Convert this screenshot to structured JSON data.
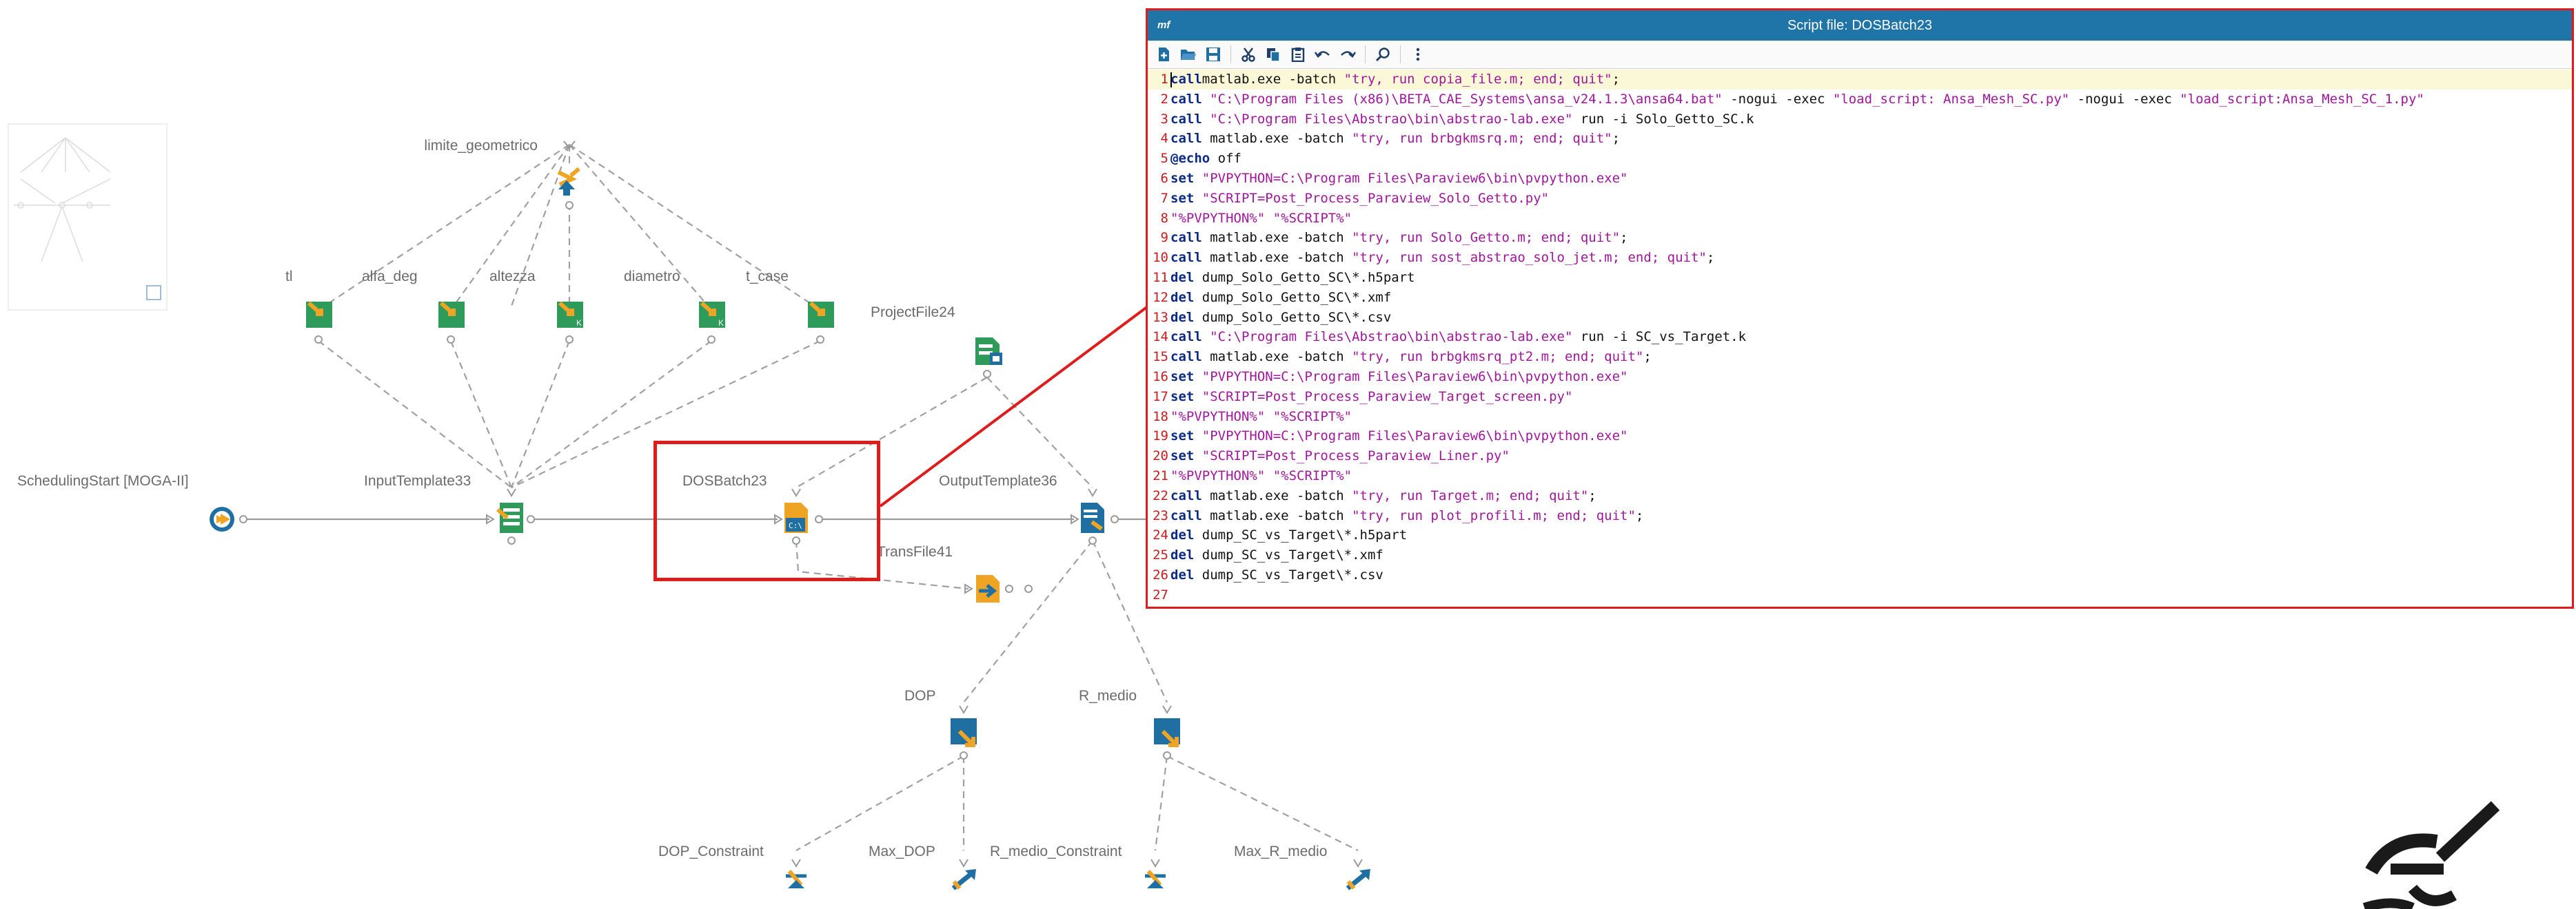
{
  "workflow": {
    "nodes": [
      {
        "id": "limite_geometrico",
        "label": "limite_geometrico",
        "icon": "transfer-function-icon"
      },
      {
        "id": "tl",
        "label": "tl",
        "icon": "input-variable-icon"
      },
      {
        "id": "alfa_deg",
        "label": "alfa_deg",
        "icon": "input-variable-icon"
      },
      {
        "id": "altezza",
        "label": "altezza",
        "icon": "input-variable-k-icon"
      },
      {
        "id": "diametro",
        "label": "diametro",
        "icon": "input-variable-k-icon"
      },
      {
        "id": "t_case",
        "label": "t_case",
        "icon": "input-variable-icon"
      },
      {
        "id": "ProjectFile24",
        "label": "ProjectFile24",
        "icon": "project-file-icon"
      },
      {
        "id": "SchedulingStart",
        "label": "SchedulingStart [MOGA-II]",
        "icon": "scheduler-start-icon"
      },
      {
        "id": "InputTemplate33",
        "label": "InputTemplate33",
        "icon": "input-template-icon"
      },
      {
        "id": "DOSBatch23",
        "label": "DOSBatch23",
        "icon": "dos-batch-icon"
      },
      {
        "id": "OutputTemplate36",
        "label": "OutputTemplate36",
        "icon": "output-template-icon"
      },
      {
        "id": "TransFile41",
        "label": "TransFile41",
        "icon": "transfer-file-icon"
      },
      {
        "id": "DOP",
        "label": "DOP",
        "icon": "output-variable-icon"
      },
      {
        "id": "R_medio",
        "label": "R_medio",
        "icon": "output-variable-icon"
      },
      {
        "id": "DOP_Constraint",
        "label": "DOP_Constraint",
        "icon": "constraint-icon"
      },
      {
        "id": "Max_DOP",
        "label": "Max_DOP",
        "icon": "objective-max-icon"
      },
      {
        "id": "R_medio_Constraint",
        "label": "R_medio_Constraint",
        "icon": "constraint-icon"
      },
      {
        "id": "Max_R_medio",
        "label": "Max_R_medio",
        "icon": "objective-max-icon"
      }
    ]
  },
  "script_window": {
    "title": "Script file: DOSBatch23",
    "logo": "mf",
    "toolbar": [
      "new-file-icon",
      "open-folder-icon",
      "save-icon",
      "cut-icon",
      "copy-icon",
      "paste-icon",
      "undo-icon",
      "redo-icon",
      "search-icon",
      "more-icon"
    ],
    "lines": [
      {
        "n": "1",
        "t": [
          [
            "kw",
            "call"
          ],
          [
            "",
            "matlab.exe -batch "
          ],
          [
            "str",
            "\"try, run copia_file.m; end; quit\""
          ],
          [
            "",
            ";"
          ]
        ]
      },
      {
        "n": "2",
        "t": [
          [
            "kw",
            "call"
          ],
          [
            "str",
            " \"C:\\Program Files (x86)\\BETA_CAE_Systems\\ansa_v24.1.3\\ansa64.bat\""
          ],
          [
            "",
            " -nogui -exec "
          ],
          [
            "str",
            "\"load_script: Ansa_Mesh_SC.py\""
          ],
          [
            "",
            " -nogui -exec "
          ],
          [
            "str",
            "\"load_script:Ansa_Mesh_SC_1.py\""
          ]
        ]
      },
      {
        "n": "3",
        "t": [
          [
            "kw",
            "call"
          ],
          [
            "str",
            " \"C:\\Program Files\\Abstrao\\bin\\abstrao-lab.exe\""
          ],
          [
            "",
            " run -i Solo_Getto_SC.k"
          ]
        ]
      },
      {
        "n": "4",
        "t": [
          [
            "kw",
            "call"
          ],
          [
            "",
            " matlab.exe -batch "
          ],
          [
            "str",
            "\"try, run brbgkmsrq.m; end; quit\""
          ],
          [
            "",
            ";"
          ]
        ]
      },
      {
        "n": "5",
        "t": [
          [
            "kw",
            "@echo"
          ],
          [
            "",
            " off"
          ]
        ]
      },
      {
        "n": "6",
        "t": [
          [
            "kw",
            "set"
          ],
          [
            "str",
            " \"PVPYTHON=C:\\Program Files\\Paraview6\\bin\\pvpython.exe\""
          ]
        ]
      },
      {
        "n": "7",
        "t": [
          [
            "kw",
            "set"
          ],
          [
            "str",
            " \"SCRIPT=Post_Process_Paraview_Solo_Getto.py\""
          ]
        ]
      },
      {
        "n": "8",
        "t": [
          [
            "str",
            "\"%PVPYTHON%\" \"%SCRIPT%\""
          ]
        ]
      },
      {
        "n": "9",
        "t": [
          [
            "kw",
            "call"
          ],
          [
            "",
            " matlab.exe -batch "
          ],
          [
            "str",
            "\"try, run Solo_Getto.m; end; quit\""
          ],
          [
            "",
            ";"
          ]
        ]
      },
      {
        "n": "10",
        "t": [
          [
            "kw",
            "call"
          ],
          [
            "",
            " matlab.exe -batch "
          ],
          [
            "str",
            "\"try, run sost_abstrao_solo_jet.m; end; quit\""
          ],
          [
            "",
            ";"
          ]
        ]
      },
      {
        "n": "11",
        "t": [
          [
            "kw",
            "del"
          ],
          [
            "",
            " dump_Solo_Getto_SC\\*.h5part"
          ]
        ]
      },
      {
        "n": "12",
        "t": [
          [
            "kw",
            "del"
          ],
          [
            "",
            " dump_Solo_Getto_SC\\*.xmf"
          ]
        ]
      },
      {
        "n": "13",
        "t": [
          [
            "kw",
            "del"
          ],
          [
            "",
            " dump_Solo_Getto_SC\\*.csv"
          ]
        ]
      },
      {
        "n": "14",
        "t": [
          [
            "kw",
            "call"
          ],
          [
            "str",
            " \"C:\\Program Files\\Abstrao\\bin\\abstrao-lab.exe\""
          ],
          [
            "",
            " run -i SC_vs_Target.k"
          ]
        ]
      },
      {
        "n": "15",
        "t": [
          [
            "kw",
            "call"
          ],
          [
            "",
            " matlab.exe -batch "
          ],
          [
            "str",
            "\"try, run brbgkmsrq_pt2.m; end; quit\""
          ],
          [
            "",
            ";"
          ]
        ]
      },
      {
        "n": "16",
        "t": [
          [
            "kw",
            "set"
          ],
          [
            "str",
            " \"PVPYTHON=C:\\Program Files\\Paraview6\\bin\\pvpython.exe\""
          ]
        ]
      },
      {
        "n": "17",
        "t": [
          [
            "kw",
            "set"
          ],
          [
            "str",
            " \"SCRIPT=Post_Process_Paraview_Target_screen.py\""
          ]
        ]
      },
      {
        "n": "18",
        "t": [
          [
            "str",
            "\"%PVPYTHON%\" \"%SCRIPT%\""
          ]
        ]
      },
      {
        "n": "19",
        "t": [
          [
            "kw",
            "set"
          ],
          [
            "str",
            " \"PVPYTHON=C:\\Program Files\\Paraview6\\bin\\pvpython.exe\""
          ]
        ]
      },
      {
        "n": "20",
        "t": [
          [
            "kw",
            "set"
          ],
          [
            "str",
            " \"SCRIPT=Post_Process_Paraview_Liner.py\""
          ]
        ]
      },
      {
        "n": "21",
        "t": [
          [
            "str",
            "\"%PVPYTHON%\" \"%SCRIPT%\""
          ]
        ]
      },
      {
        "n": "22",
        "t": [
          [
            "kw",
            "call"
          ],
          [
            "",
            " matlab.exe -batch "
          ],
          [
            "str",
            "\"try, run Target.m; end; quit\""
          ],
          [
            "",
            ";"
          ]
        ]
      },
      {
        "n": "23",
        "t": [
          [
            "kw",
            "call"
          ],
          [
            "",
            " matlab.exe -batch "
          ],
          [
            "str",
            "\"try, run plot_profili.m; end; quit\""
          ],
          [
            "",
            ";"
          ]
        ]
      },
      {
        "n": "24",
        "t": [
          [
            "kw",
            "del"
          ],
          [
            "",
            " dump_SC_vs_Target\\*.h5part"
          ]
        ]
      },
      {
        "n": "25",
        "t": [
          [
            "kw",
            "del"
          ],
          [
            "",
            " dump_SC_vs_Target\\*.xmf"
          ]
        ]
      },
      {
        "n": "26",
        "t": [
          [
            "kw",
            "del"
          ],
          [
            "",
            " dump_SC_vs_Target\\*.csv"
          ]
        ]
      },
      {
        "n": "27",
        "t": []
      }
    ]
  },
  "colors": {
    "title_bar": "#1f74a8",
    "highlight": "#e01b1b",
    "node_green": "#2e9b5a",
    "node_orange": "#f0a424",
    "node_blue": "#1f6fa3",
    "keyword": "#0b2a86",
    "string": "#a1169c",
    "line_number": "#cc1b1b"
  }
}
